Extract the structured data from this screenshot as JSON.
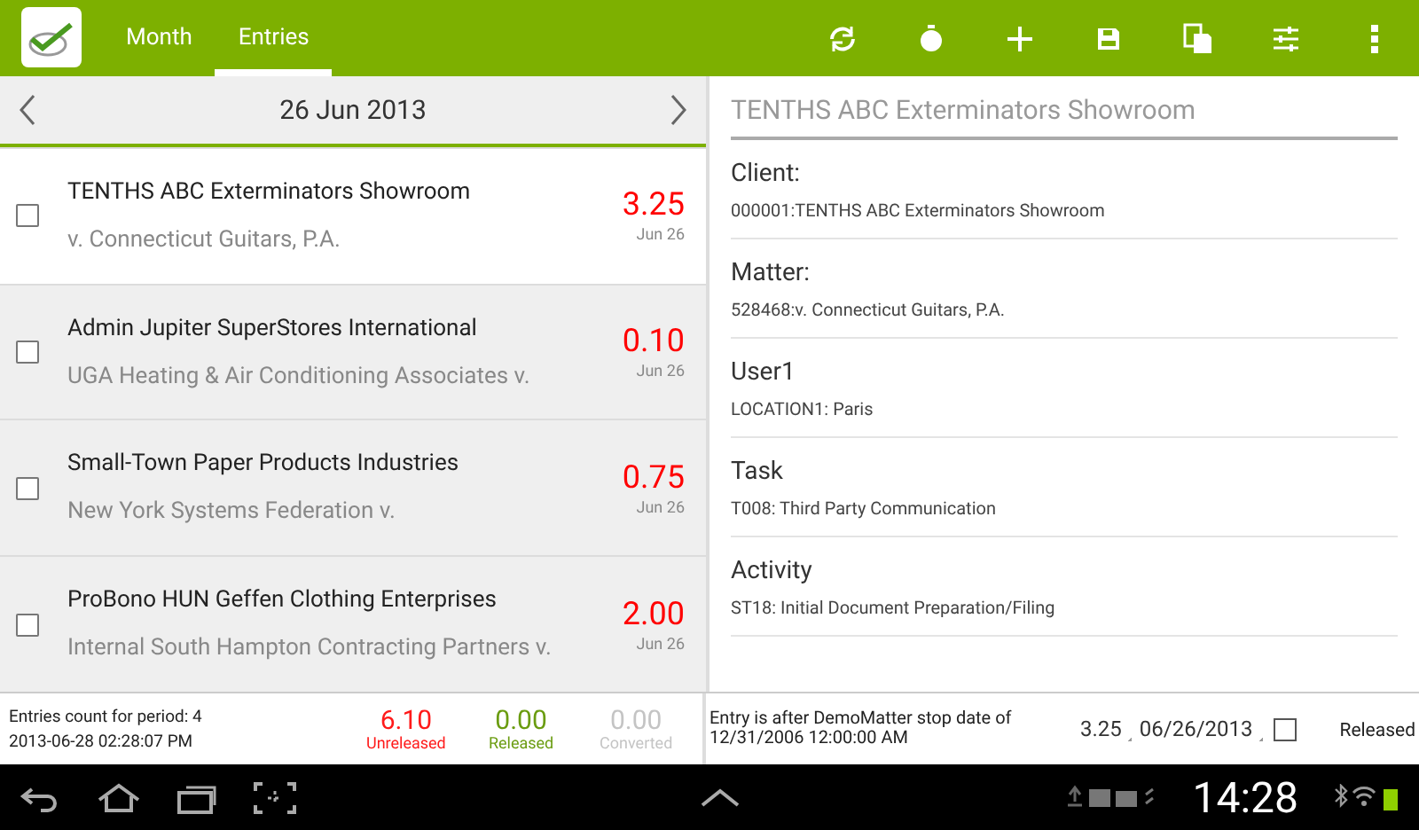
{
  "tabs": [
    {
      "label": "Month",
      "selected": false
    },
    {
      "label": "Entries",
      "selected": true
    }
  ],
  "date_nav": {
    "date": "26 Jun 2013"
  },
  "entries": [
    {
      "client": "TENTHS ABC Exterminators Showroom",
      "matter": "v. Connecticut Guitars, P.A.",
      "hours": "3.25",
      "date": "Jun 26",
      "checked": false,
      "selected": true
    },
    {
      "client": "Admin Jupiter SuperStores International",
      "matter": "UGA Heating & Air Conditioning Associates v.",
      "hours": "0.10",
      "date": "Jun 26",
      "checked": false,
      "selected": false
    },
    {
      "client": "Small-Town Paper Products Industries",
      "matter": "New York Systems Federation v.",
      "hours": "0.75",
      "date": "Jun 26",
      "checked": false,
      "selected": false
    },
    {
      "client": "ProBono HUN Geffen Clothing Enterprises",
      "matter": "Internal South Hampton Contracting Partners v.",
      "hours": "2.00",
      "date": "Jun 26",
      "checked": false,
      "selected": false
    }
  ],
  "summary": {
    "count": "Entries count for period: 4",
    "timestamp": "2013-06-28 02:28:07 PM",
    "totals": [
      {
        "value": "6.10",
        "label": "Unreleased",
        "color": "#ff1a1a"
      },
      {
        "value": "0.00",
        "label": "Released",
        "color": "#6a9c10"
      },
      {
        "value": "0.00",
        "label": "Converted",
        "color": "#c4c4c4"
      }
    ]
  },
  "detail": {
    "title": "TENTHS ABC Exterminators Showroom",
    "fields": [
      {
        "label": "Client:",
        "value": "000001:TENTHS ABC Exterminators Showroom"
      },
      {
        "label": "Matter:",
        "value": "528468:v. Connecticut Guitars, P.A."
      },
      {
        "label": "User1",
        "value": "LOCATION1: Paris"
      },
      {
        "label": "Task",
        "value": "T008: Third Party Communication"
      },
      {
        "label": "Activity",
        "value": "ST18: Initial Document Preparation/Filing"
      }
    ]
  },
  "detail_footer": {
    "message": "Entry is after DemoMatter stop date of 12/31/2006 12:00:00 AM",
    "hours": "3.25",
    "date": "06/26/2013",
    "released": false,
    "released_label": "Released"
  },
  "status_bar": {
    "time": "14:28"
  }
}
